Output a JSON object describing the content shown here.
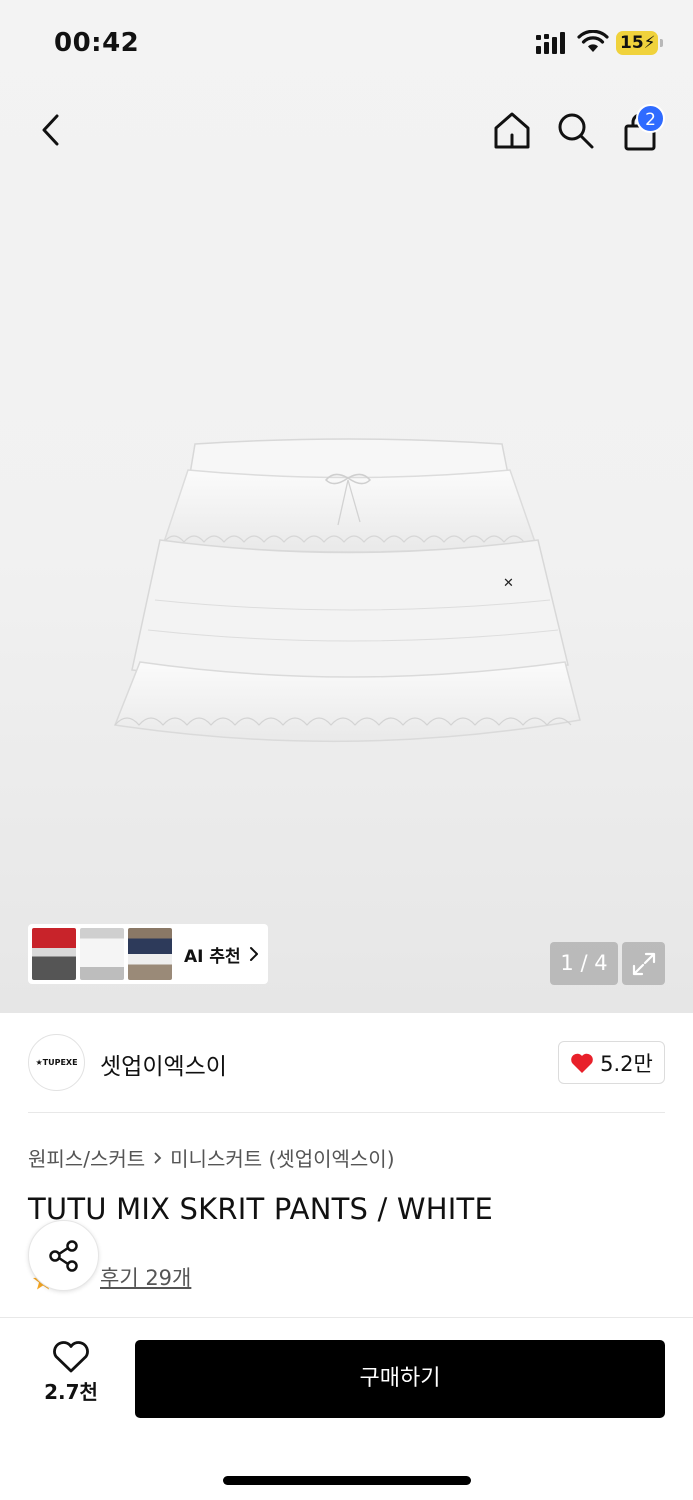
{
  "status_bar": {
    "time": "00:42",
    "battery": "15"
  },
  "nav": {
    "cart_count": "2"
  },
  "gallery": {
    "ai_recommend_label": "AI 추천",
    "page_counter": "1 / 4"
  },
  "brand": {
    "logo_text": "★TUPEXE",
    "name": "셋업이엑스이",
    "likes": "5.2만"
  },
  "breadcrumb": {
    "category": "원피스/스커트",
    "subcategory": "미니스커트 (셋업이엑스이)"
  },
  "product": {
    "title": "TUTU MIX SKRIT PANTS / WHITE",
    "reviews_label": "후기 29개"
  },
  "bottom_bar": {
    "wish_count": "2.7천",
    "buy_label": "구매하기"
  },
  "colors": {
    "accent_blue": "#2f6bff",
    "heart_red": "#e8202a",
    "buy_black": "#000000",
    "battery_yellow": "#f0d23c"
  }
}
